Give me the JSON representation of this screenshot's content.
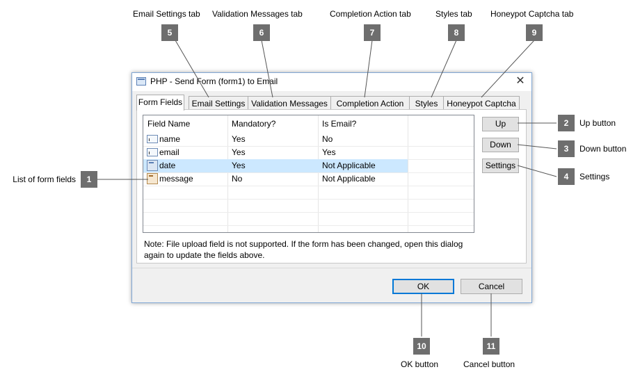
{
  "dialog": {
    "title": "PHP - Send Form (form1) to Email",
    "close_glyph": "✕",
    "tabs": [
      {
        "label": "Form Fields",
        "active": true
      },
      {
        "label": "Email Settings"
      },
      {
        "label": "Validation Messages"
      },
      {
        "label": "Completion Action"
      },
      {
        "label": "Styles"
      },
      {
        "label": "Honeypot Captcha"
      }
    ],
    "fields_table": {
      "headers": [
        "Field Name",
        "Mandatory?",
        "Is Email?"
      ],
      "rows": [
        {
          "name": "name",
          "mandatory": "Yes",
          "is_email": "No",
          "icon": "text-field-icon"
        },
        {
          "name": "email",
          "mandatory": "Yes",
          "is_email": "Yes",
          "icon": "text-field-icon"
        },
        {
          "name": "date",
          "mandatory": "Yes",
          "is_email": "Not Applicable",
          "icon": "date-field-icon",
          "selected": true
        },
        {
          "name": "message",
          "mandatory": "No",
          "is_email": "Not Applicable",
          "icon": "textarea-field-icon"
        }
      ]
    },
    "side_buttons": {
      "up": "Up",
      "down": "Down",
      "settings": "Settings"
    },
    "note": "Note: File upload field is not supported. If the form has been changed, open this dialog again to update the fields above.",
    "ok_label": "OK",
    "cancel_label": "Cancel"
  },
  "callouts": [
    {
      "number": "1",
      "label": "List of form fields"
    },
    {
      "number": "2",
      "label": "Up button"
    },
    {
      "number": "3",
      "label": "Down button"
    },
    {
      "number": "4",
      "label": "Settings"
    },
    {
      "number": "5",
      "label": "Email Settings tab"
    },
    {
      "number": "6",
      "label": "Validation Messages tab"
    },
    {
      "number": "7",
      "label": "Completion Action tab"
    },
    {
      "number": "8",
      "label": "Styles tab"
    },
    {
      "number": "9",
      "label": "Honeypot Captcha tab"
    },
    {
      "number": "10",
      "label": "OK button"
    },
    {
      "number": "11",
      "label": "Cancel button"
    }
  ],
  "colors": {
    "accent": "#0078d7",
    "selection": "#cce8ff",
    "badge": "#6e6e6e",
    "window_border": "#7fa6d4"
  }
}
